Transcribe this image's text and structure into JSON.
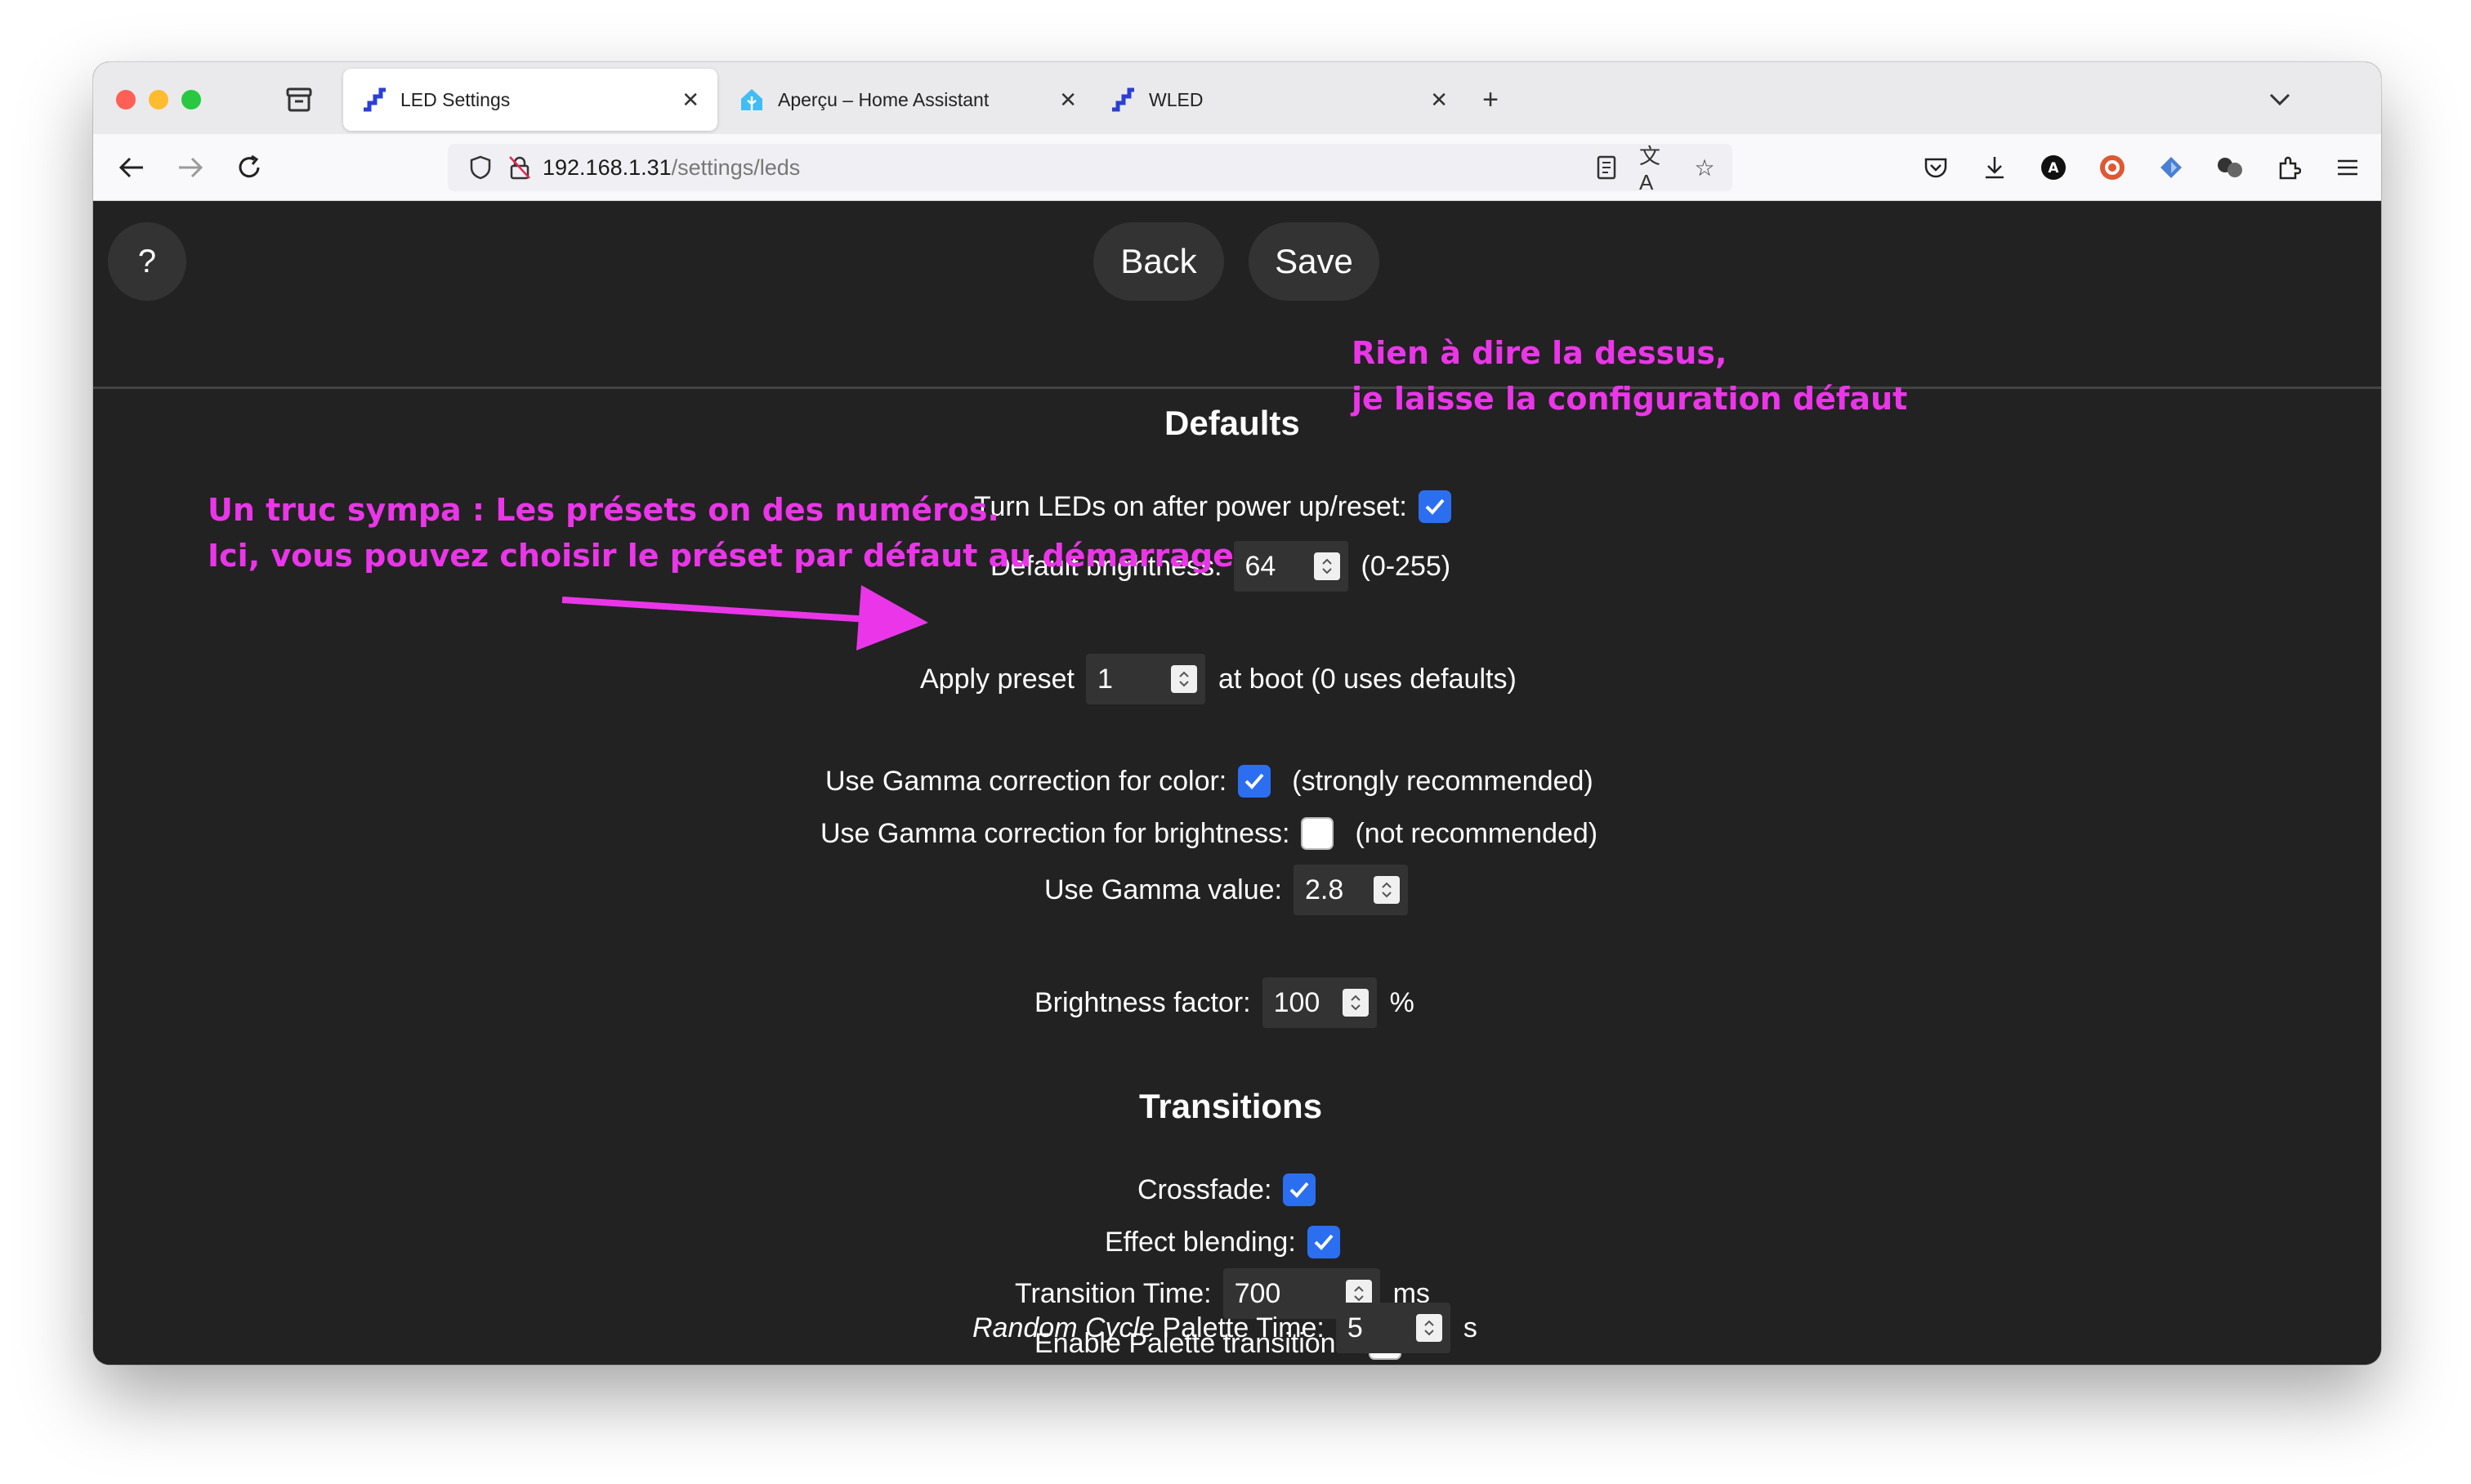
{
  "browser": {
    "tabs": [
      {
        "title": "LED Settings",
        "favicon": "wled-icon",
        "active": true
      },
      {
        "title": "Aperçu – Home Assistant",
        "favicon": "home-assistant-icon",
        "active": false
      },
      {
        "title": "WLED",
        "favicon": "wled-icon",
        "active": false
      }
    ],
    "url_host": "192.168.1.31",
    "url_path": "/settings/leds"
  },
  "topbar": {
    "help_label": "?",
    "back_label": "Back",
    "save_label": "Save"
  },
  "defaults": {
    "heading": "Defaults",
    "turn_on_label": "Turn LEDs on after power up/reset:",
    "turn_on_checked": true,
    "brightness_label": "Default brightness:",
    "brightness_value": "64",
    "brightness_range": "(0-255)",
    "preset_label": "Apply preset",
    "preset_value": "1",
    "preset_suffix": "at boot (0 uses defaults)",
    "gamma_color_label": "Use Gamma correction for color:",
    "gamma_color_checked": true,
    "gamma_color_note": "(strongly recommended)",
    "gamma_brightness_label": "Use Gamma correction for brightness:",
    "gamma_brightness_checked": false,
    "gamma_brightness_note": "(not recommended)",
    "gamma_value_label": "Use Gamma value:",
    "gamma_value": "2.8",
    "brightness_factor_label": "Brightness factor:",
    "brightness_factor_value": "100",
    "brightness_factor_unit": "%"
  },
  "transitions": {
    "heading": "Transitions",
    "crossfade_label": "Crossfade:",
    "crossfade_checked": true,
    "effect_blending_label": "Effect blending:",
    "effect_blending_checked": true,
    "transition_time_label": "Transition Time:",
    "transition_time_value": "700",
    "transition_time_unit": "ms",
    "palette_transitions_label": "Enable Palette transitions:",
    "palette_transitions_checked": false,
    "random_cycle_italic": "Random Cycle",
    "random_cycle_label": " Palette Time:",
    "random_cycle_value": "5",
    "random_cycle_unit": "s"
  },
  "annotations": {
    "right_line1": "Rien à dire la dessus,",
    "right_line2": "je laisse la configuration défaut",
    "left_line1": "Un truc sympa : Les présets on des numéros.",
    "left_line2": "Ici, vous pouvez choisir le préset par défaut au démarrage",
    "color": "#ea36e8"
  },
  "colors": {
    "page_bg": "#222222",
    "control_bg": "#333333",
    "checkbox_blue": "#2b6ff0"
  }
}
